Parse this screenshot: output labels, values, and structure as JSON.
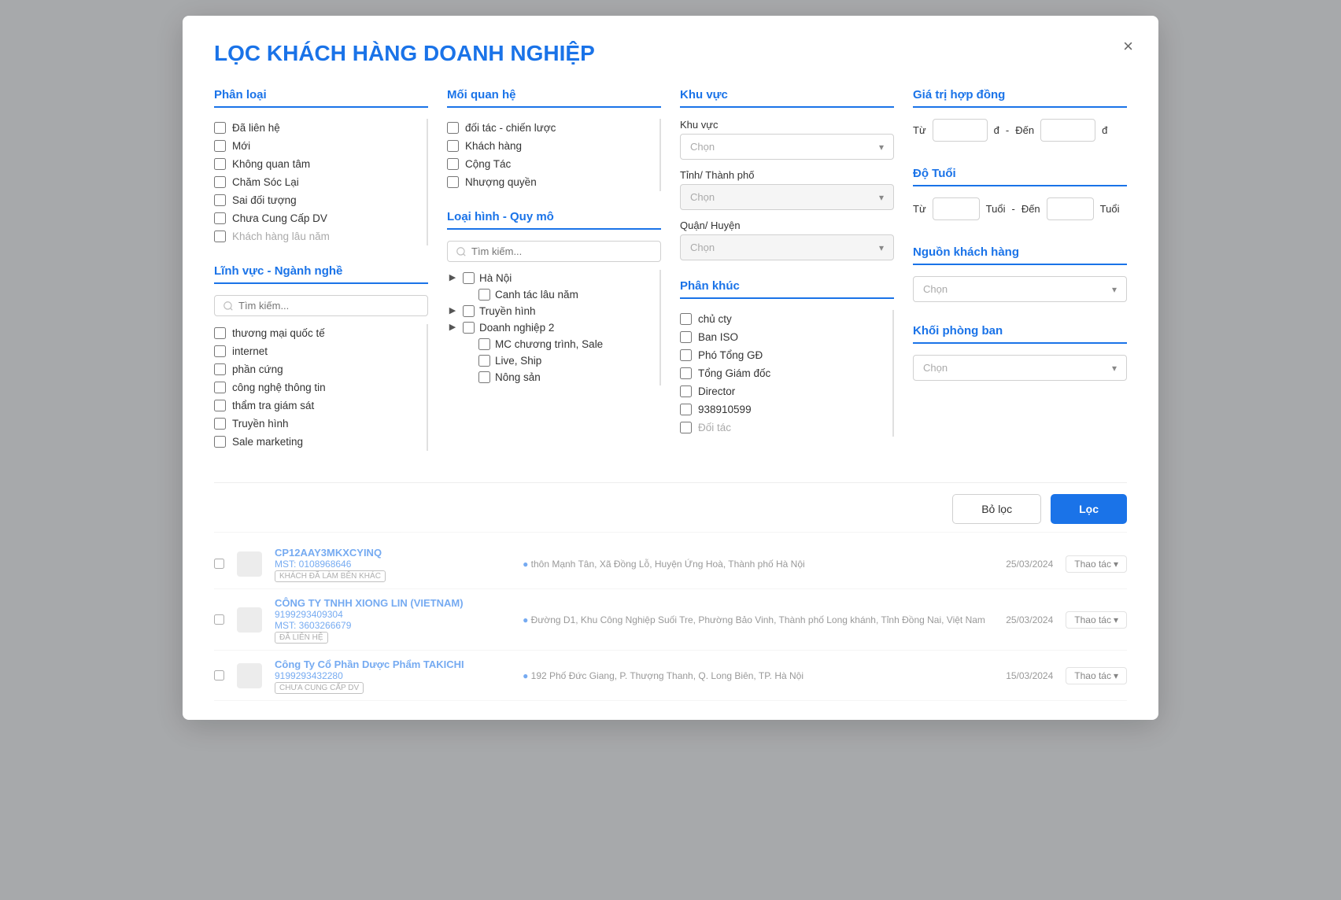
{
  "modal": {
    "title": "LỌC KHÁCH HÀNG DOANH NGHIỆP",
    "close_label": "×"
  },
  "phan_loai": {
    "title": "Phân loại",
    "items": [
      "Đã liên hệ",
      "Mới",
      "Không quan tâm",
      "Chăm Sóc Lại",
      "Sai đối tượng",
      "Chưa Cung Cấp DV",
      "Khách hàng lâu năm"
    ]
  },
  "moi_quan_he": {
    "title": "Mối quan hệ",
    "items": [
      "đối tác - chiến lược",
      "Khách hàng",
      "Cộng Tác",
      "Nhượng quyền"
    ]
  },
  "khu_vuc": {
    "title": "Khu vực",
    "khu_vuc_label": "Khu vực",
    "tinh_label": "Tỉnh/ Thành phố",
    "quan_label": "Quận/ Huyện",
    "placeholder": "Chọn"
  },
  "gia_tri": {
    "title": "Giá trị hợp đồng",
    "from_label": "Từ",
    "to_label": "Đến",
    "unit": "đ"
  },
  "linh_vuc": {
    "title": "Lĩnh vực - Ngành nghề",
    "search_placeholder": "Tìm kiếm...",
    "items": [
      "thương mại quốc tế",
      "internet",
      "phần cứng",
      "công nghệ thông tin",
      "thẩm tra giám sát",
      "Truyền hình",
      "Sale marketing"
    ]
  },
  "loai_hinh": {
    "title": "Loại hình - Quy mô",
    "search_placeholder": "Tìm kiếm...",
    "items": [
      {
        "label": "Hà Nội",
        "has_children": true,
        "children": []
      },
      {
        "label": "Canh tác lâu năm",
        "has_children": false,
        "children": []
      },
      {
        "label": "Truyền hình",
        "has_children": true,
        "children": []
      },
      {
        "label": "Doanh nghiệp 2",
        "has_children": true,
        "children": []
      },
      {
        "label": "MC chương trình, Sale",
        "has_children": false,
        "children": []
      },
      {
        "label": "Live, Ship",
        "has_children": false,
        "children": []
      },
      {
        "label": "Nông sản",
        "has_children": false,
        "children": []
      }
    ]
  },
  "phan_khuc": {
    "title": "Phân khúc",
    "items": [
      "chủ cty",
      "Ban ISO",
      "Phó Tổng GĐ",
      "Tổng Giám đốc",
      "Director",
      "938910599",
      "Đối tác"
    ]
  },
  "do_tuoi": {
    "title": "Độ Tuổi",
    "from_label": "Từ",
    "to_label": "Đến",
    "unit": "Tuổi"
  },
  "nguon_kh": {
    "title": "Nguồn khách hàng",
    "placeholder": "Chọn"
  },
  "khoi_pb": {
    "title": "Khối phòng ban",
    "placeholder": "Chọn"
  },
  "buttons": {
    "reset": "Bỏ lọc",
    "filter": "Lọc"
  },
  "bg_rows": [
    {
      "company": "CP12AAY3MKXCYINQ",
      "tax": "MST: 0108968646",
      "badge": "KHÁCH ĐÃ LÀM BÊN KHÁC",
      "address": "thôn Mạnh Tân, Xã Đồng Lỗ, Huyện Ứng Hoà, Thành phố Hà Nội",
      "date": "25/03/2024",
      "action": "Thao tác"
    },
    {
      "company": "CÔNG TY TNHH XIONG LIN (VIETNAM)",
      "tax": "MST: 3603266679",
      "phone": "9199293409304",
      "badge": "ĐÃ LIÊN HỆ",
      "address": "Đường D1, Khu Công Nghiệp Suối Tre, Phường Bảo Vinh, Thành phố Long khánh, Tỉnh Đồng Nai, Việt Nam",
      "date": "25/03/2024",
      "action": "Thao tác"
    },
    {
      "company": "Công Ty Cổ Phần Dược Phẩm TAKICHI",
      "phone": "9199293432280",
      "badge": "CHƯA CUNG CẤP DV",
      "address": "192 Phố Đức Giang, P. Thượng Thanh, Q. Long Biên, TP. Hà Nội",
      "date": "15/03/2024",
      "action": "Thao tác"
    }
  ]
}
